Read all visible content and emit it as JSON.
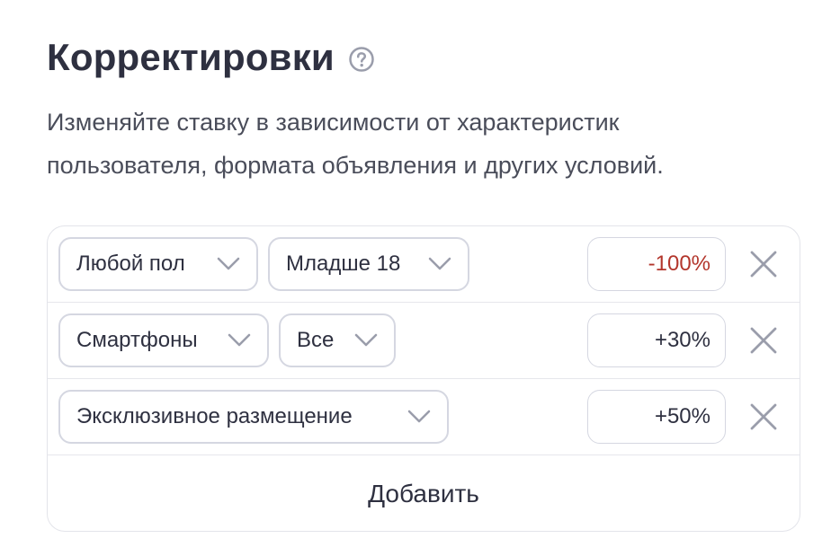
{
  "header": {
    "title": "Корректировки",
    "help_icon": "question-circle-icon"
  },
  "description": "Изменяйте ставку в зависимости от характеристик пользователя, формата объявления и других условий.",
  "rows": [
    {
      "selects": [
        "Любой пол",
        "Младше 18"
      ],
      "value": "-100%",
      "negative": true
    },
    {
      "selects": [
        "Смартфоны",
        "Все"
      ],
      "value": "+30%",
      "negative": false
    },
    {
      "selects": [
        "Эксклюзивное размещение"
      ],
      "value": "+50%",
      "negative": false
    }
  ],
  "add_label": "Добавить",
  "colors": {
    "negative": "#b3362c",
    "border": "#d5d7e1",
    "text": "#2e3040",
    "icon": "#9a9dab"
  }
}
